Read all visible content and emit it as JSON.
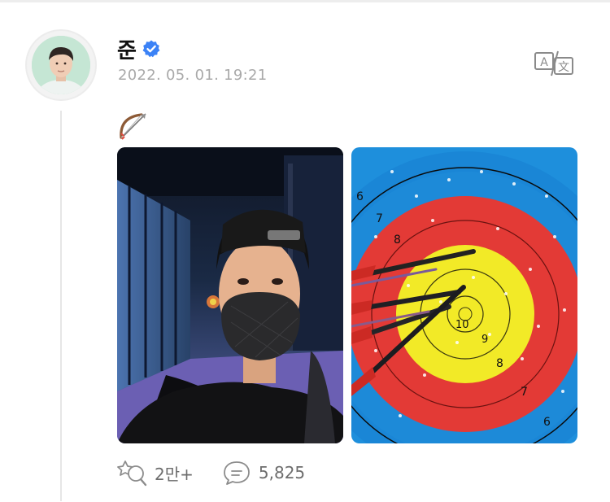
{
  "post": {
    "author_name": "준",
    "timestamp": "2022. 05. 01. 19:21",
    "text_emoji": "🏹",
    "verified": true,
    "translate_label": "translate",
    "photos": [
      {
        "description": "selfie in archery range wearing black cap and mask"
      },
      {
        "description": "archery target with arrows in gold"
      }
    ],
    "target_ring_numbers": [
      "6",
      "7",
      "8",
      "9",
      "9",
      "10",
      "8",
      "7",
      "6"
    ]
  },
  "actions": {
    "likes_count": "2만+",
    "comments_count": "5,825"
  },
  "colors": {
    "verified_blue": "#3b82f6",
    "meta_gray": "#a9a9a9",
    "count_gray": "#6d6d6d",
    "target_yellow": "#f2ea27",
    "target_red": "#e23a36",
    "target_blue": "#1e8fdc"
  }
}
